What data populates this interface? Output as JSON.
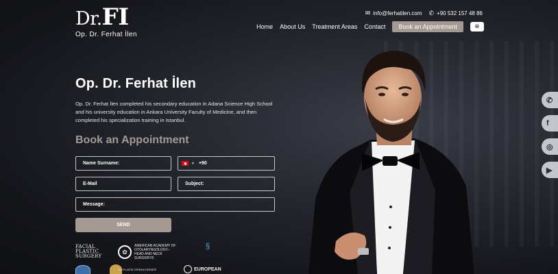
{
  "header": {
    "logo_mark": "Dr.",
    "logo_initials": "FI",
    "logo_subtitle": "Op. Dr. Ferhat İlen",
    "email": "info@ferhatilen.com",
    "phone": "+90 532 157 48 86"
  },
  "nav": {
    "items": [
      "Home",
      "About Us",
      "Treatment Areas",
      "Contact"
    ],
    "appointment_label": "Book an Appointment",
    "language_icon": "globe-icon"
  },
  "hero": {
    "title": "Op. Dr. Ferhat İlen",
    "text": "Op. Dr. Ferhat İlen completed his secondary education in Adana Science High School and his university education in Ankara University Faculty of Medicine, and then completed his specialization training in Istanbul."
  },
  "form": {
    "title": "Book an Appointment",
    "name_placeholder": "Name Surname:",
    "phone_code": "+90",
    "email_placeholder": "E-Mail",
    "subject_placeholder": "Subject:",
    "message_placeholder": "Message:",
    "send_label": "SEND"
  },
  "logos": {
    "fps_line1": "FACIAL",
    "fps_line2": "PLASTIC",
    "fps_line3": "SURGERY",
    "aao_line1": "AMERICAN ACADEMY OF",
    "aao_line2": "OTOLARYNGOLOGY–",
    "aao_line3": "HEAD AND NECK SURGERY®",
    "yuz_text": "YÜZ PLASTİK CERRAHİ DERNEĞİ",
    "eu_line1": "EUROPEAN"
  },
  "socials": [
    "whatsapp-icon",
    "facebook-icon",
    "instagram-icon",
    "youtube-icon"
  ],
  "colors": {
    "accent": "#a49993",
    "background": "#1b1c22"
  }
}
